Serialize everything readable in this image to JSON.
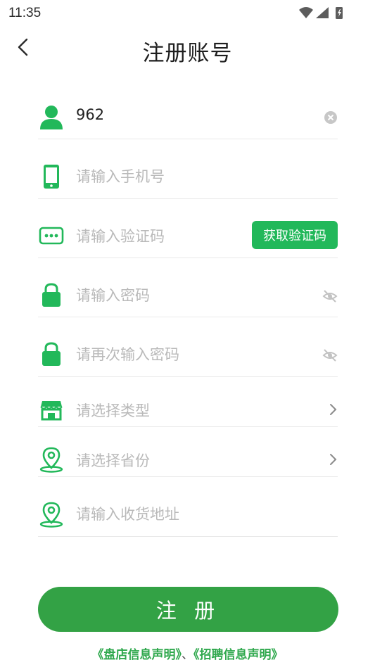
{
  "status_bar": {
    "time": "11:35"
  },
  "header": {
    "title": "注册账号"
  },
  "form": {
    "username": {
      "value": "962"
    },
    "phone": {
      "placeholder": "请输入手机号"
    },
    "code": {
      "placeholder": "请输入验证码",
      "button_label": "获取验证码"
    },
    "password": {
      "placeholder": "请输入密码"
    },
    "password_confirm": {
      "placeholder": "请再次输入密码"
    },
    "type_select": {
      "placeholder": "请选择类型"
    },
    "province_select": {
      "placeholder": "请选择省份"
    },
    "address": {
      "placeholder": "请输入收货地址"
    }
  },
  "register_button": {
    "label": "注 册"
  },
  "agreements": {
    "store_statement": "《盘店信息声明》",
    "separator": "、",
    "recruit_statement": "《招聘信息声明》"
  },
  "colors": {
    "accent": "#22b85a",
    "button": "#33a245",
    "placeholder": "#b9b9b9"
  },
  "icons": [
    "user-icon",
    "phone-icon",
    "sms-icon",
    "lock-icon",
    "store-icon",
    "location-icon",
    "eye-off-icon",
    "chevron-right-icon",
    "clear-icon"
  ]
}
